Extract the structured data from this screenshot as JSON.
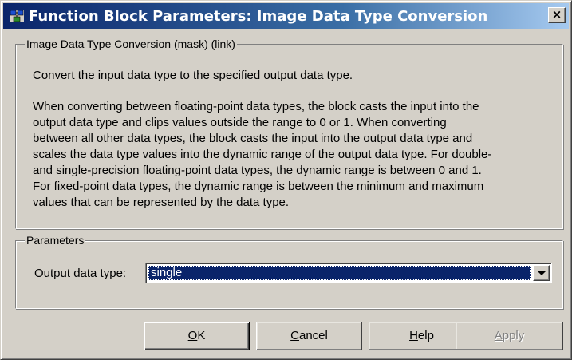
{
  "window": {
    "title": "Function Block Parameters: Image Data Type Conversion",
    "close_label": "×"
  },
  "description": {
    "legend": "Image Data Type Conversion (mask) (link)",
    "summary": "Convert the input data type to the specified output data type.",
    "details": [
      "When converting between floating-point data types, the block casts the input into the",
      "output data type and clips values outside the range to 0 or 1. When converting",
      "between all other data types, the block casts the input into the output data type and",
      "scales the data type values into the dynamic range of the output data type. For double-",
      "and single-precision floating-point data types, the dynamic range is between 0 and 1.",
      "For fixed-point data types, the dynamic range is between the minimum and maximum",
      "values that can be represented by the data type."
    ]
  },
  "parameters": {
    "legend": "Parameters",
    "output_data_type": {
      "label": "Output data type:",
      "value": "single"
    }
  },
  "buttons": {
    "ok": {
      "mnemonic": "O",
      "rest": "K"
    },
    "cancel": {
      "mnemonic": "C",
      "rest": "ancel"
    },
    "help": {
      "mnemonic": "H",
      "rest": "elp"
    },
    "apply": {
      "mnemonic": "A",
      "rest": "pply"
    }
  }
}
